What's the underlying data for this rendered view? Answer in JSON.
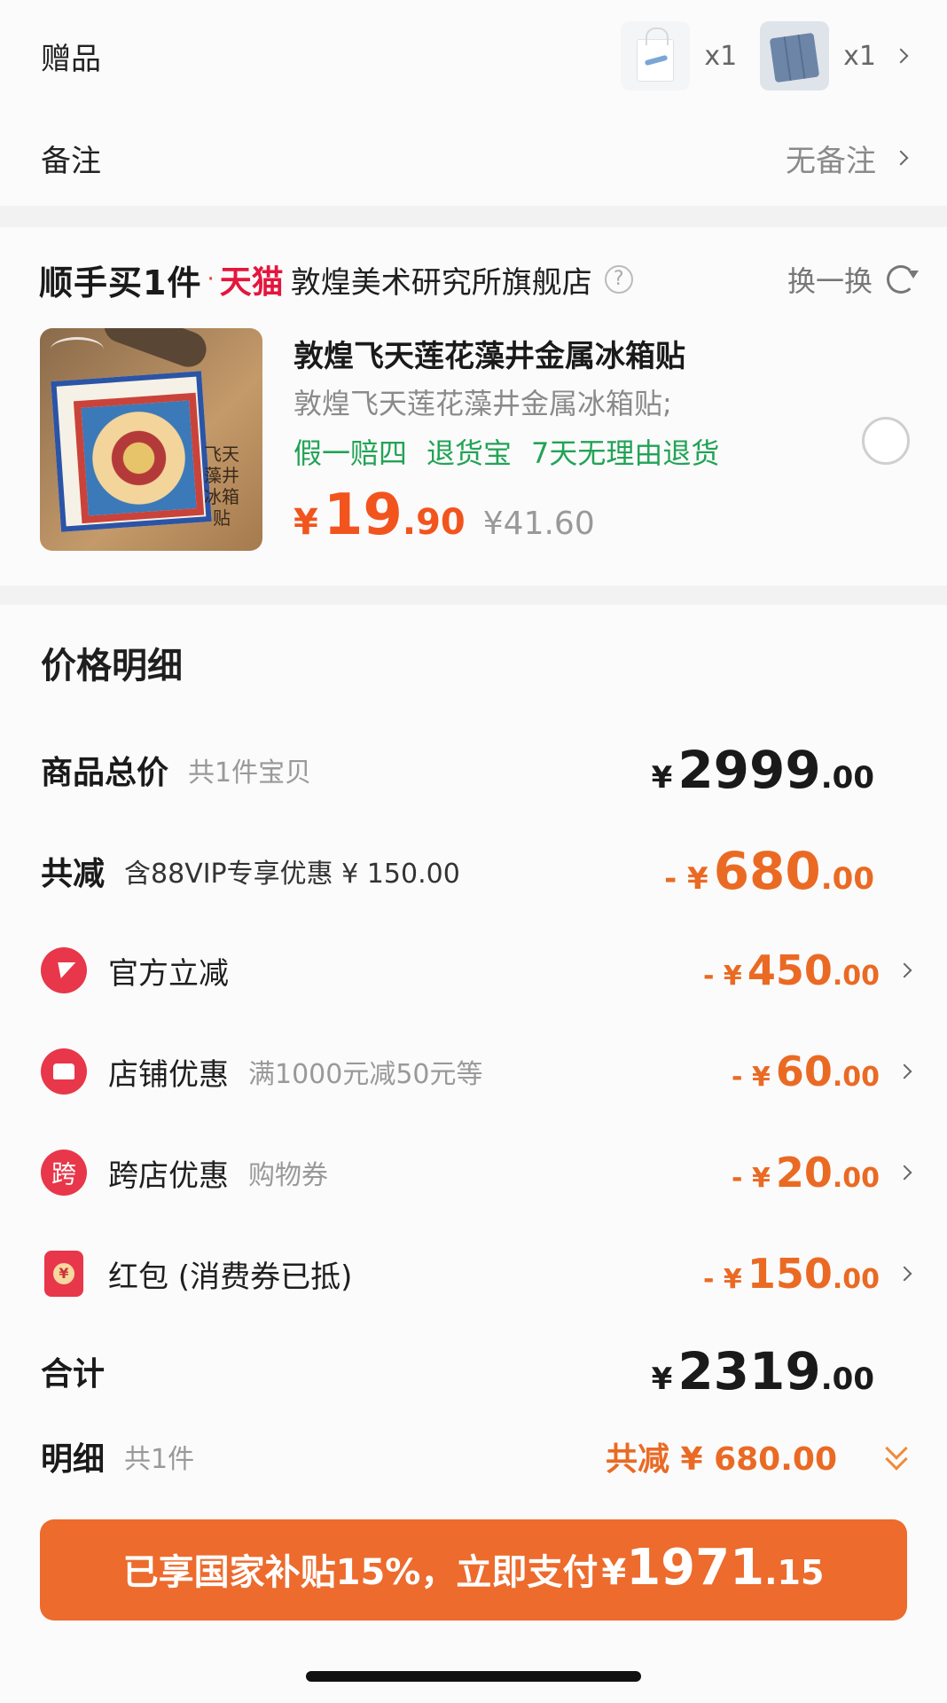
{
  "gifts": {
    "label": "赠品",
    "items": [
      {
        "icon": "tote-bag-thumbnail",
        "qty": "x1"
      },
      {
        "icon": "mouse-pad-thumbnail",
        "qty": "x1"
      }
    ]
  },
  "note": {
    "label": "备注",
    "value": "无备注"
  },
  "recommend": {
    "brand": "顺手买1件",
    "dot": "·",
    "platform": "天猫",
    "shop": "敦煌美术研究所旗舰店",
    "help": "?",
    "swap": "换一换",
    "product": {
      "image_text": "飞天藻井 冰箱贴",
      "title": "敦煌飞天莲花藻井金属冰箱贴",
      "subtitle": "敦煌飞天莲花藻井金属冰箱贴;",
      "tags": [
        "假一赔四",
        "退货宝",
        "7天无理由退货"
      ],
      "price_symbol": "¥",
      "price_int": "19",
      "price_dec": ".90",
      "orig_price": "¥41.60"
    }
  },
  "detail": {
    "title": "价格明细",
    "total": {
      "label": "商品总价",
      "hint": "共1件宝贝",
      "cur": "¥",
      "int": "2999",
      "dec": ".00"
    },
    "discount": {
      "label": "共减",
      "hint": "含88VIP专享优惠 ¥ 150.00",
      "cur": "- ¥",
      "int": "680",
      "dec": ".00"
    },
    "items": [
      {
        "icon": "lightning-icon",
        "label": "官方立减",
        "hint": "",
        "cur": "- ¥",
        "int": "450",
        "dec": ".00"
      },
      {
        "icon": "store-icon",
        "label": "店铺优惠",
        "hint": "满1000元减50元等",
        "cur": "- ¥",
        "int": "60",
        "dec": ".00"
      },
      {
        "icon": "cross-store-icon",
        "icon_text": "跨",
        "label": "跨店优惠",
        "hint": "购物券",
        "cur": "- ¥",
        "int": "20",
        "dec": ".00"
      },
      {
        "icon": "red-envelope-icon",
        "icon_text": "¥",
        "label": "红包 (消费券已抵)",
        "hint": "",
        "cur": "- ¥",
        "int": "150",
        "dec": ".00"
      }
    ],
    "sum": {
      "label": "合计",
      "cur": "¥",
      "int": "2319",
      "dec": ".00"
    },
    "breakdown": {
      "label": "明细",
      "hint": "共1件",
      "saving": "共减 ¥ 680.00"
    }
  },
  "pay": {
    "text": "已享国家补贴15%，立即支付",
    "cur": "¥",
    "int": "1971",
    "dec": ".15"
  },
  "colors": {
    "accent": "#ec6b2d",
    "discount": "#ea6a24",
    "green_tag": "#22a356",
    "tmall_red": "#e4163c"
  }
}
